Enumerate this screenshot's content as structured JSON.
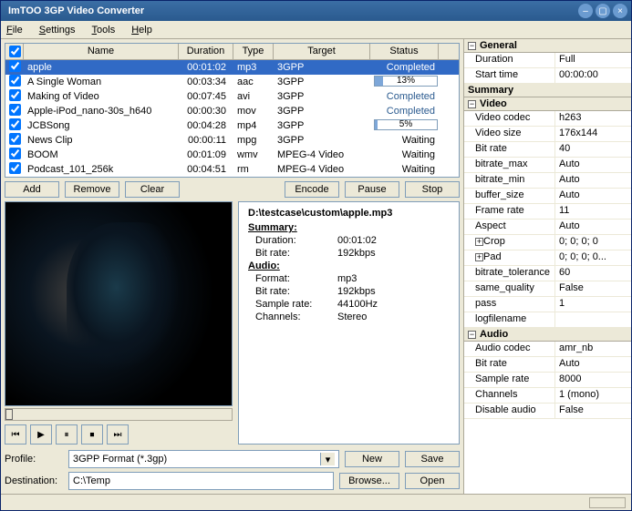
{
  "window": {
    "title": "ImTOO 3GP Video Converter"
  },
  "menu": {
    "file": "File",
    "settings": "Settings",
    "tools": "Tools",
    "help": "Help"
  },
  "grid": {
    "headers": {
      "name": "Name",
      "duration": "Duration",
      "type": "Type",
      "target": "Target",
      "status": "Status"
    },
    "rows": [
      {
        "checked": true,
        "name": "apple",
        "duration": "00:01:02",
        "type": "mp3",
        "target": "3GPP",
        "status_type": "completed",
        "status": "Completed",
        "selected": true
      },
      {
        "checked": true,
        "name": "A Single Woman",
        "duration": "00:03:34",
        "type": "aac",
        "target": "3GPP",
        "status_type": "progress",
        "progress": 13,
        "status": "13%"
      },
      {
        "checked": true,
        "name": "Making of Video",
        "duration": "00:07:45",
        "type": "avi",
        "target": "3GPP",
        "status_type": "completed",
        "status": "Completed"
      },
      {
        "checked": true,
        "name": "Apple-iPod_nano-30s_h640",
        "duration": "00:00:30",
        "type": "mov",
        "target": "3GPP",
        "status_type": "completed",
        "status": "Completed"
      },
      {
        "checked": true,
        "name": "JCBSong",
        "duration": "00:04:28",
        "type": "mp4",
        "target": "3GPP",
        "status_type": "progress",
        "progress": 5,
        "status": "5%"
      },
      {
        "checked": true,
        "name": "News Clip",
        "duration": "00:00:11",
        "type": "mpg",
        "target": "3GPP",
        "status_type": "waiting",
        "status": "Waiting"
      },
      {
        "checked": true,
        "name": "BOOM",
        "duration": "00:01:09",
        "type": "wmv",
        "target": "MPEG-4 Video",
        "status_type": "waiting",
        "status": "Waiting"
      },
      {
        "checked": true,
        "name": "Podcast_101_256k",
        "duration": "00:04:51",
        "type": "rm",
        "target": "MPEG-4 Video",
        "status_type": "waiting",
        "status": "Waiting"
      }
    ]
  },
  "buttons": {
    "add": "Add",
    "remove": "Remove",
    "clear": "Clear",
    "encode": "Encode",
    "pause": "Pause",
    "stop": "Stop",
    "new": "New",
    "save": "Save",
    "browse": "Browse...",
    "open": "Open"
  },
  "details": {
    "path": "D:\\testcase\\custom\\apple.mp3",
    "summary_hdr": "Summary:",
    "audio_hdr": "Audio:",
    "duration_k": "Duration:",
    "duration_v": "00:01:02",
    "bitrate_k": "Bit rate:",
    "bitrate_v": "192kbps",
    "format_k": "Format:",
    "format_v": "mp3",
    "abitrate_k": "Bit rate:",
    "abitrate_v": "192kbps",
    "srate_k": "Sample rate:",
    "srate_v": "44100Hz",
    "channels_k": "Channels:",
    "channels_v": "Stereo"
  },
  "form": {
    "profile_label": "Profile:",
    "profile_value": "3GPP Format  (*.3gp)",
    "dest_label": "Destination:",
    "dest_value": "C:\\Temp"
  },
  "props": {
    "general": "General",
    "duration_k": "Duration",
    "duration_v": "Full",
    "start_k": "Start time",
    "start_v": "00:00:00",
    "summary": "Summary",
    "video": "Video",
    "vcodec_k": "Video codec",
    "vcodec_v": "h263",
    "vsize_k": "Video size",
    "vsize_v": "176x144",
    "vbr_k": "Bit rate",
    "vbr_v": "40",
    "brmax_k": "bitrate_max",
    "brmax_v": "Auto",
    "brmin_k": "bitrate_min",
    "brmin_v": "Auto",
    "buf_k": "buffer_size",
    "buf_v": "Auto",
    "fr_k": "Frame rate",
    "fr_v": "11",
    "aspect_k": "Aspect",
    "aspect_v": "Auto",
    "crop_k": "Crop",
    "crop_v": "0; 0; 0; 0",
    "pad_k": "Pad",
    "pad_v": "0; 0; 0; 0...",
    "btol_k": "bitrate_tolerance",
    "btol_v": "60",
    "sq_k": "same_quality",
    "sq_v": "False",
    "pass_k": "pass",
    "pass_v": "1",
    "log_k": "logfilename",
    "log_v": "",
    "audio": "Audio",
    "acodec_k": "Audio codec",
    "acodec_v": "amr_nb",
    "abr_k": "Bit rate",
    "abr_v": "Auto",
    "asr_k": "Sample rate",
    "asr_v": "8000",
    "ach_k": "Channels",
    "ach_v": "1 (mono)",
    "adis_k": "Disable audio",
    "adis_v": "False"
  }
}
